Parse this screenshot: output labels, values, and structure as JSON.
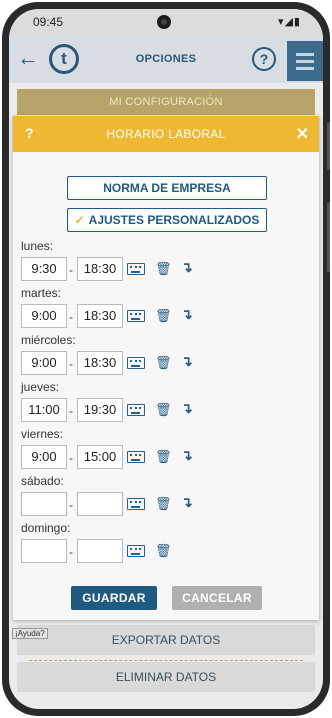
{
  "status_bar": {
    "time": "09:45",
    "icons": "▾◢▮"
  },
  "app_header": {
    "title": "OPCIONES",
    "logo_letter": "t",
    "help_label": "?"
  },
  "background": {
    "my_config_label": "MI CONFIGURACIÓN",
    "export_label": "EXPORTAR DATOS",
    "delete_label": "ELIMINAR DATOS",
    "ayuda_label": "¡Ayuda?"
  },
  "dialog": {
    "help_label": "?",
    "title": "HORARIO LABORAL",
    "close_label": "✕",
    "company_norm_label": "NORMA DE EMPRESA",
    "custom_settings_label": "AJUSTES PERSONALIZADOS",
    "custom_settings_checked": true,
    "days": [
      {
        "label": "lunes:",
        "start": "9:30",
        "end": "18:30",
        "has_copy": true
      },
      {
        "label": "martes:",
        "start": "9:00",
        "end": "18:30",
        "has_copy": true
      },
      {
        "label": "miércoles:",
        "start": "9:00",
        "end": "18:30",
        "has_copy": true
      },
      {
        "label": "jueves:",
        "start": "11:00",
        "end": "19:30",
        "has_copy": true
      },
      {
        "label": "viernes:",
        "start": "9:00",
        "end": "15:00",
        "has_copy": true
      },
      {
        "label": "sábado:",
        "start": "",
        "end": "",
        "has_copy": true
      },
      {
        "label": "domingo:",
        "start": "",
        "end": "",
        "has_copy": false
      }
    ],
    "dash": "-",
    "save_label": "GUARDAR",
    "cancel_label": "CANCELAR"
  },
  "colors": {
    "dialog_header": "#efb832",
    "primary_button": "#1f5a80",
    "cancel_button": "#b0b0b0",
    "icon_blue": "#2a5f8a"
  }
}
